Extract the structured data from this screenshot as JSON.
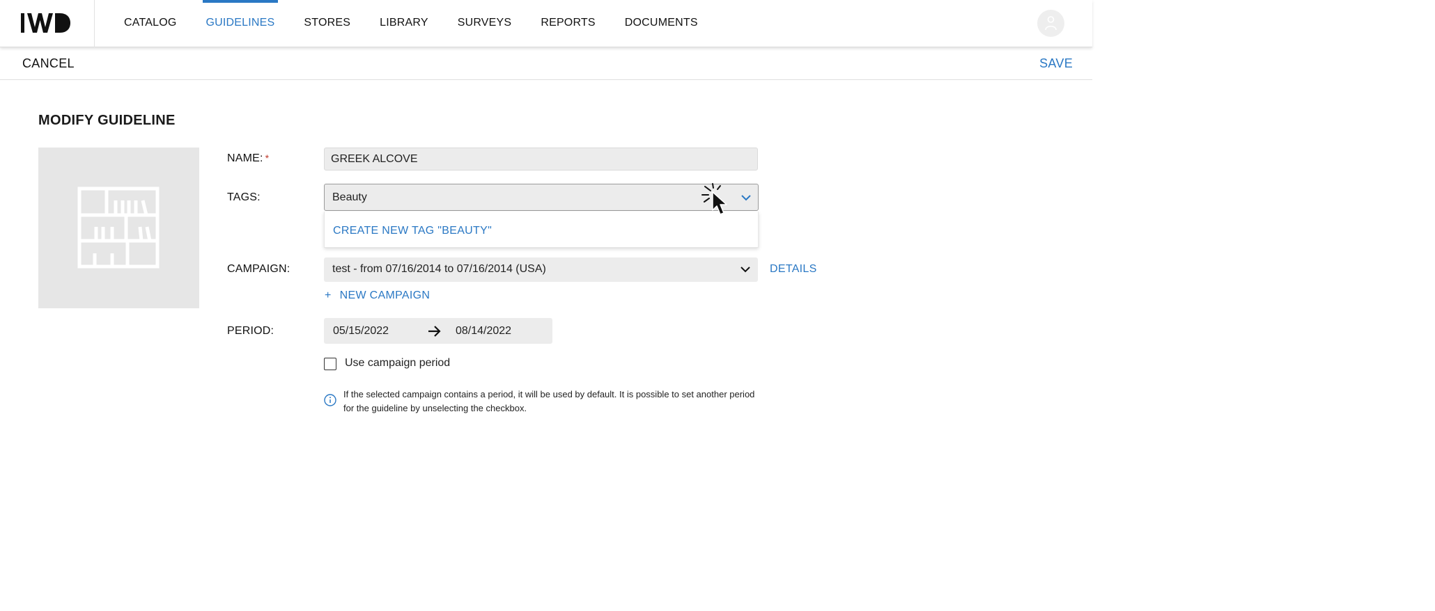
{
  "app": {
    "logo_text": "IWD"
  },
  "nav": {
    "items": [
      {
        "label": "CATALOG"
      },
      {
        "label": "GUIDELINES"
      },
      {
        "label": "STORES"
      },
      {
        "label": "LIBRARY"
      },
      {
        "label": "SURVEYS"
      },
      {
        "label": "REPORTS"
      },
      {
        "label": "DOCUMENTS"
      }
    ],
    "active": "GUIDELINES"
  },
  "actionbar": {
    "cancel_label": "CANCEL",
    "save_label": "SAVE"
  },
  "page": {
    "title": "MODIFY GUIDELINE"
  },
  "form": {
    "name": {
      "label": "NAME:",
      "required_mark": "*",
      "value": "GREEK ALCOVE"
    },
    "tags": {
      "label": "TAGS:",
      "value": "Beauty",
      "dropdown_option": "CREATE NEW TAG \"BEAUTY\""
    },
    "campaign": {
      "label": "CAMPAIGN:",
      "value": "test - from 07/16/2014 to 07/16/2014 (USA)",
      "details_label": "DETAILS",
      "new_campaign_plus": "+",
      "new_campaign_label": "NEW CAMPAIGN"
    },
    "period": {
      "label": "PERIOD:",
      "start": "05/15/2022",
      "end": "08/14/2022"
    },
    "use_campaign_period": {
      "label": "Use campaign period",
      "checked": false
    },
    "info_text": "If the selected campaign contains a period, it will be used by default. It is possible to set another period for the guideline by unselecting the checkbox."
  },
  "colors": {
    "accent": "#2a78c4",
    "field_bg": "#ececec",
    "thumb_bg": "#e6e6e6"
  },
  "icons": [
    "avatar-icon",
    "chevron-down-icon",
    "arrow-right-icon",
    "info-icon",
    "shelf-placeholder-icon",
    "mouse-cursor-icon"
  ]
}
